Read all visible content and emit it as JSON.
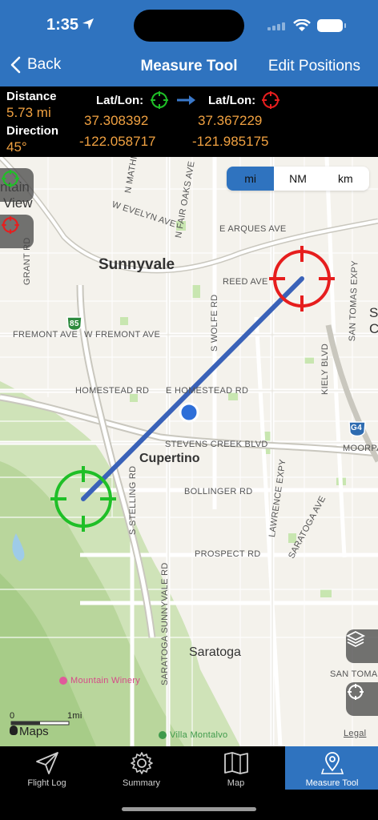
{
  "status": {
    "time": "1:35"
  },
  "nav": {
    "back_label": "Back",
    "title": "Measure Tool",
    "edit_label": "Edit Positions"
  },
  "info": {
    "distance_label": "Distance",
    "distance_value": "5.73 mi",
    "direction_label": "Direction",
    "direction_value": "45°",
    "latlon_label_start": "Lat/Lon:",
    "latlon_label_end": "Lat/Lon:",
    "start_lat": "37.308392",
    "start_lon": "-122.058717",
    "end_lat": "37.367229",
    "end_lon": "-121.985175"
  },
  "units": {
    "options": [
      "mi",
      "NM",
      "km"
    ],
    "selected": "mi"
  },
  "map": {
    "cities": {
      "sunnyvale": "Sunnyvale",
      "cupertino": "Cupertino",
      "saratoga": "Saratoga"
    },
    "city_fragments": {
      "mountain_view_1": "ntain",
      "mountain_view_2": "View",
      "edge_s": "S",
      "edge_c": "C"
    },
    "streets": {
      "evelyn": "W EVELYN AVE",
      "arques": "E ARQUES AVE",
      "reed": "REED AVE",
      "fremont": "W FREMONT AVE",
      "fremont_left": "FREMONT AVE",
      "homestead": "HOMESTEAD RD",
      "e_homestead": "E HOMESTEAD RD",
      "stevens": "STEVENS CREEK BLVD",
      "bollinger": "BOLLINGER RD",
      "prospect": "PROSPECT RD",
      "mathilda": "N MATHILDA AVE",
      "fair_oaks": "N FAIR OAKS AVE",
      "wolfe": "S WOLFE RD",
      "stelling": "S STELLING RD",
      "saratoga_sunnyvale": "SARATOGA SUNNYVALE RD",
      "lawrence": "LAWRENCE EXPY",
      "saratoga_ave": "SARATOGA AVE",
      "kiely": "KIELY BLVD",
      "san_tomas_expy": "SAN TOMAS EXPY",
      "san_tomas": "SAN TOMAS",
      "moorpark": "MOORPAR",
      "grant": "GRANT RD"
    },
    "shields": {
      "hwy85": "85",
      "g4": "G4"
    },
    "poi": {
      "winery": "Mountain Winery",
      "montalvo": "Villa Montalvo"
    },
    "scale": {
      "zero": "0",
      "one": "1mi"
    },
    "attribution": "Maps",
    "legal": "Legal"
  },
  "tabs": [
    {
      "label": "Flight Log",
      "icon": "paper-plane-icon"
    },
    {
      "label": "Summary",
      "icon": "gear-icon"
    },
    {
      "label": "Map",
      "icon": "folded-map-icon"
    },
    {
      "label": "Measure Tool",
      "icon": "map-pin-icon"
    }
  ],
  "active_tab": "Measure Tool",
  "colors": {
    "header_blue": "#2f73bf",
    "value_orange": "#f0a141",
    "start_marker": "#1fbf27",
    "end_marker": "#e61e1e",
    "measure_line": "#3a62b8",
    "user_location": "#2e6fd8"
  }
}
